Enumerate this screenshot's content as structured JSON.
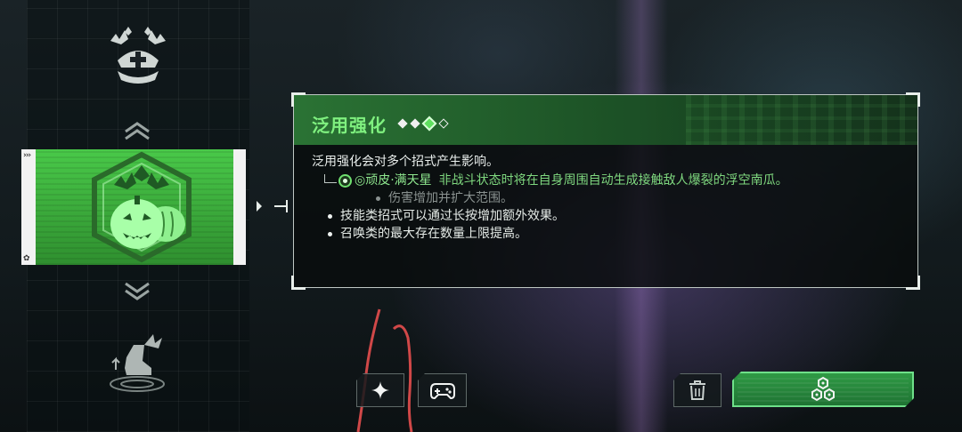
{
  "skill_panel": {
    "title": "泛用强化",
    "rank": {
      "levels": 4,
      "current": 3
    },
    "description": "泛用强化会对多个招式产生影响。",
    "sub_effect": {
      "name": "◎顽皮·满天星",
      "text": "非战斗状态时将在自身周围自动生成接触敌人爆裂的浮空南瓜。",
      "detail": "伤害增加并扩大范围。"
    },
    "bullets": [
      "技能类招式可以通过长按增加额外效果。",
      "召唤类的最大存在数量上限提高。"
    ]
  },
  "left_column": {
    "top_icon": "bat-crown-icon",
    "selected_icon": "pumpkin-bats-icon",
    "bottom_icon": "winged-boot-icon"
  },
  "buttons": {
    "spark_icon": "sparkle-icon",
    "gamepad_icon": "gamepad-icon",
    "trash_icon": "trash-icon",
    "confirm_icon": "hex-cluster-icon"
  },
  "colors": {
    "accent_green": "#5fe05f",
    "title_green": "#7ff07f",
    "sub_green": "#8fe88f",
    "muted_gray": "#8a9290"
  }
}
